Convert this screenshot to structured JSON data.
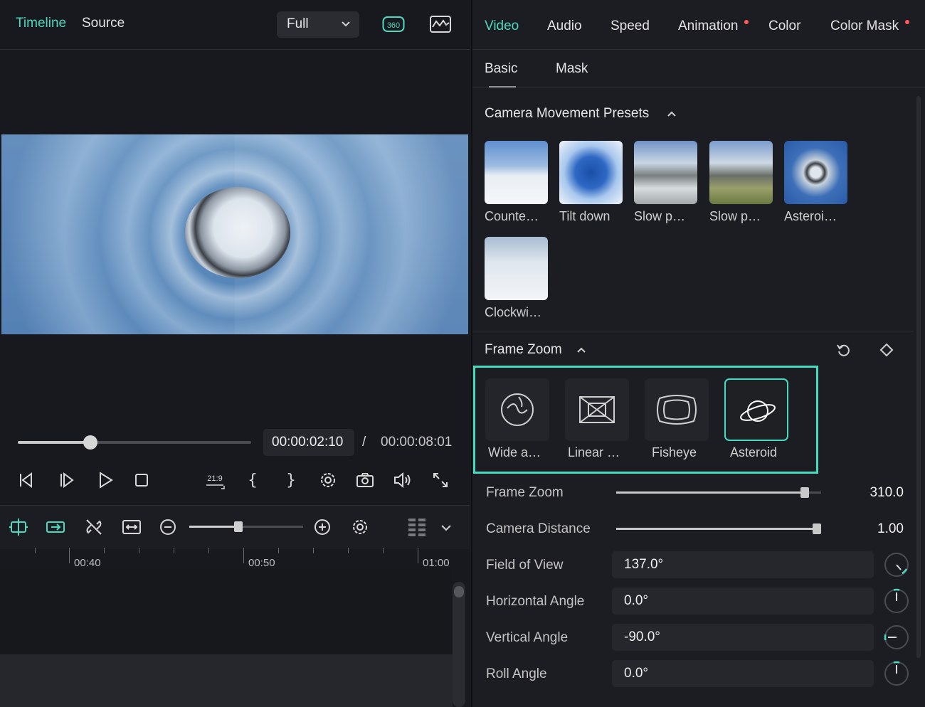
{
  "player": {
    "tabs": [
      {
        "label": "Timeline"
      },
      {
        "label": "Source"
      }
    ],
    "zoom": "Full",
    "btn_360_label": "360",
    "time_current": "00:00:02:10",
    "time_separator": "/",
    "time_total": "00:00:08:01",
    "progress": 0.31,
    "aspect_label": "21:9"
  },
  "timeline": {
    "zoom_level": 0.43,
    "ruler_labels": [
      "00:40",
      "00:50",
      "01:00"
    ]
  },
  "properties": {
    "tabs": [
      {
        "label": "Video",
        "active": true,
        "dot": false
      },
      {
        "label": "Audio",
        "active": false,
        "dot": false
      },
      {
        "label": "Speed",
        "active": false,
        "dot": false
      },
      {
        "label": "Animation",
        "active": false,
        "dot": true
      },
      {
        "label": "Color",
        "active": false,
        "dot": false
      },
      {
        "label": "Color Mask",
        "active": false,
        "dot": true
      }
    ],
    "subtabs": [
      {
        "label": "Basic"
      },
      {
        "label": "Mask"
      }
    ],
    "camera_presets_title": "Camera Movement Presets",
    "presets": [
      {
        "label": "Counte…"
      },
      {
        "label": "Tilt down"
      },
      {
        "label": "Slow p…"
      },
      {
        "label": "Slow p…"
      },
      {
        "label": "Asteroi…"
      },
      {
        "label": "Clockwi…"
      }
    ],
    "frame_zoom_title": "Frame Zoom",
    "frame_zoom_modes": [
      {
        "label": "Wide a…",
        "selected": false
      },
      {
        "label": "Linear …",
        "selected": false
      },
      {
        "label": "Fisheye",
        "selected": false
      },
      {
        "label": "Asteroid",
        "selected": true
      }
    ],
    "frame_zoom": {
      "label": "Frame Zoom",
      "value": "310.0",
      "level": 0.92
    },
    "camera_distance": {
      "label": "Camera Distance",
      "value": "1.00",
      "level": 0.98
    },
    "field_of_view": {
      "label": "Field of View",
      "value": "137.0°"
    },
    "horizontal_angle": {
      "label": "Horizontal Angle",
      "value": "0.0°"
    },
    "vertical_angle": {
      "label": "Vertical Angle",
      "value": "-90.0°"
    },
    "roll_angle": {
      "label": "Roll Angle",
      "value": "0.0°"
    }
  },
  "colors": {
    "accent": "#4fd8c0",
    "highlight_box": "#44dcc0",
    "notify_dot": "#ff5a5a"
  }
}
